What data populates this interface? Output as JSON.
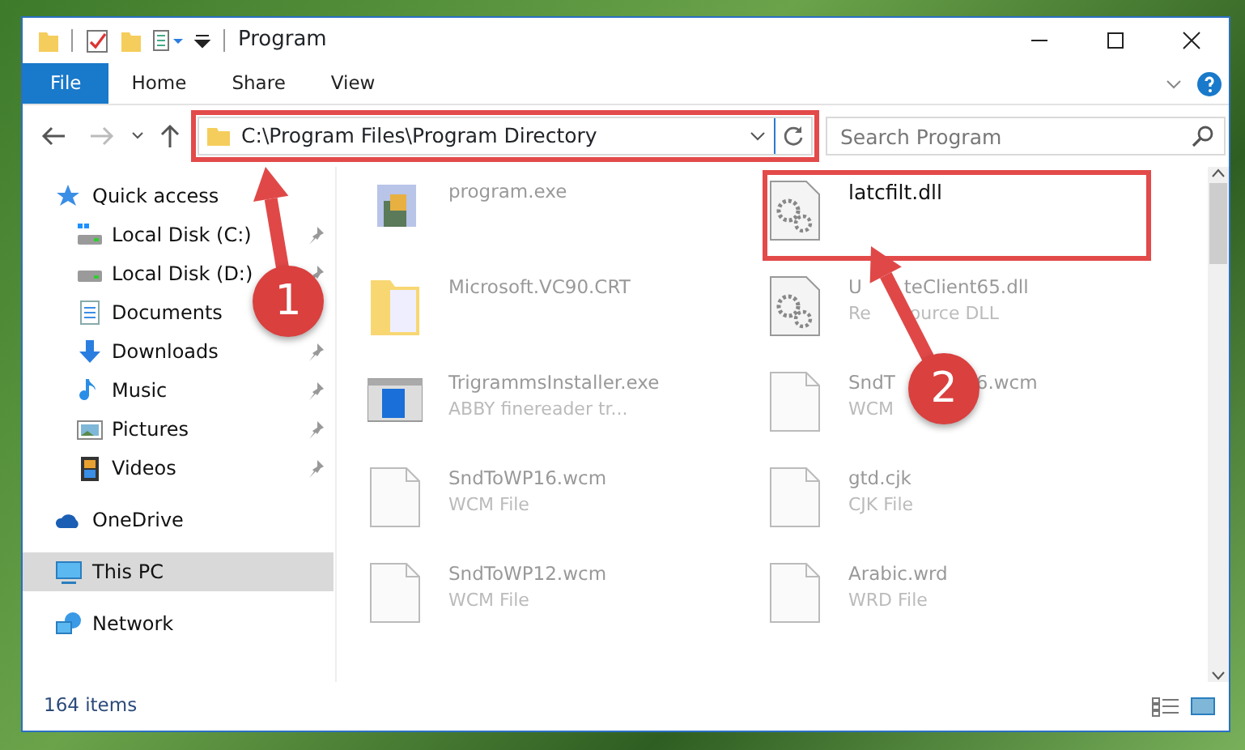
{
  "window": {
    "title": "Program"
  },
  "ribbon_tabs": [
    {
      "label": "File",
      "kind": "file"
    },
    {
      "label": "Home",
      "kind": "tab"
    },
    {
      "label": "Share",
      "kind": "tab"
    },
    {
      "label": "View",
      "kind": "tab"
    }
  ],
  "address": {
    "path": "C:\\Program Files\\Program Directory",
    "highlighted": true
  },
  "search": {
    "placeholder": "Search Program"
  },
  "sidebar": {
    "items": [
      {
        "label": "Quick access",
        "selected": false,
        "children": [
          {
            "label": "Local Disk (C:)",
            "pinned": true,
            "selected": false
          },
          {
            "label": "Local Disk (D:)",
            "pinned": true,
            "selected": false
          },
          {
            "label": "Documents",
            "pinned": false,
            "selected": false
          },
          {
            "label": "Downloads",
            "pinned": true,
            "selected": false
          },
          {
            "label": "Music",
            "pinned": true,
            "selected": false
          },
          {
            "label": "Pictures",
            "pinned": true,
            "selected": false
          },
          {
            "label": "Videos",
            "pinned": true,
            "selected": false
          }
        ]
      },
      {
        "label": "OneDrive",
        "selected": false
      },
      {
        "label": "This PC",
        "selected": true
      },
      {
        "label": "Network",
        "selected": false
      }
    ]
  },
  "files": [
    {
      "name": "program.exe",
      "kind": "exe",
      "highlighted": false
    },
    {
      "name": "latcfilt.dll",
      "kind": "dll",
      "highlighted": true
    },
    {
      "name": "Microsoft.VC90.CRT",
      "kind": "folder",
      "highlighted": false
    },
    {
      "name_segments": [
        "U",
        "teClient65.dll"
      ],
      "subtitle_segments": [
        "Re",
        "ource DLL"
      ],
      "kind": "dll",
      "highlighted": false
    },
    {
      "name": "TrigrammsInstaller.exe",
      "subtitle": "ABBY finereader tr...",
      "kind": "installer",
      "highlighted": false
    },
    {
      "name_segments": [
        "SndT",
        "6.wcm"
      ],
      "subtitle": "WCM",
      "kind": "blank",
      "highlighted": false
    },
    {
      "name": "SndToWP16.wcm",
      "subtitle": "WCM File",
      "kind": "blank",
      "highlighted": false
    },
    {
      "name": "gtd.cjk",
      "subtitle": "CJK File",
      "kind": "blank",
      "highlighted": false
    },
    {
      "name": "SndToWP12.wcm",
      "subtitle": "WCM File",
      "kind": "blank",
      "highlighted": false
    },
    {
      "name": "Arabic.wrd",
      "subtitle": "WRD File",
      "kind": "blank",
      "highlighted": false
    }
  ],
  "status_bar": {
    "count": "164 items"
  },
  "annotations": [
    {
      "number": "1"
    },
    {
      "number": "2"
    }
  ]
}
